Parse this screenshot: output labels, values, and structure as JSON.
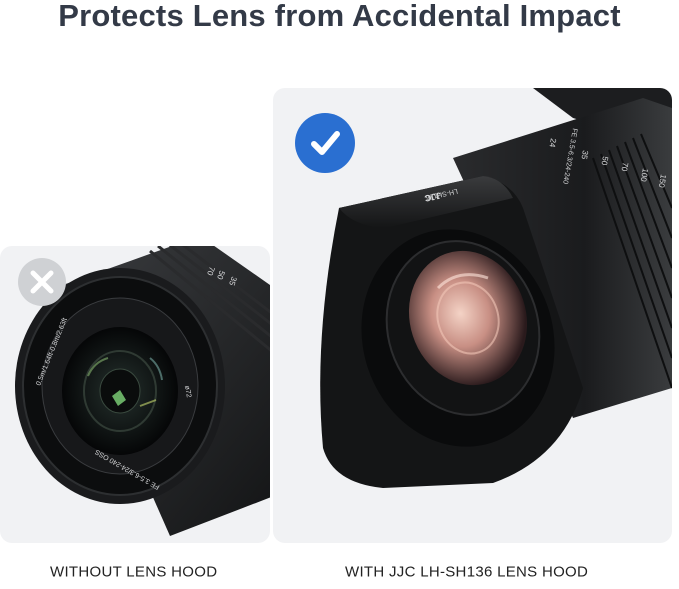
{
  "headline": "Protects Lens from Accidental Impact",
  "left_panel": {
    "caption": "WITHOUT LENS HOOD",
    "badge_icon": "x-icon",
    "lens_ring_text": "FE 3.5-6.3/24-240 OSS",
    "lens_focus_text": "0.5m/1.64ft-0.8m/2.63ft",
    "filter_text": "ø72",
    "zoom_marks": [
      "70",
      "50",
      "35"
    ]
  },
  "right_panel": {
    "caption": "WITH JJC LH-SH136 LENS HOOD",
    "badge_icon": "check-icon",
    "hood_brand": "JJC",
    "hood_model": "LH-SH136",
    "lens_ring_text": "FE 3.5-6.3/24-240",
    "zoom_marks": [
      "24",
      "35",
      "50",
      "70",
      "100",
      "150"
    ]
  },
  "colors": {
    "headline": "#333a47",
    "badge_check": "#2a6fd1",
    "badge_x": "#cfd1d4",
    "card_bg": "#f1f2f4"
  }
}
